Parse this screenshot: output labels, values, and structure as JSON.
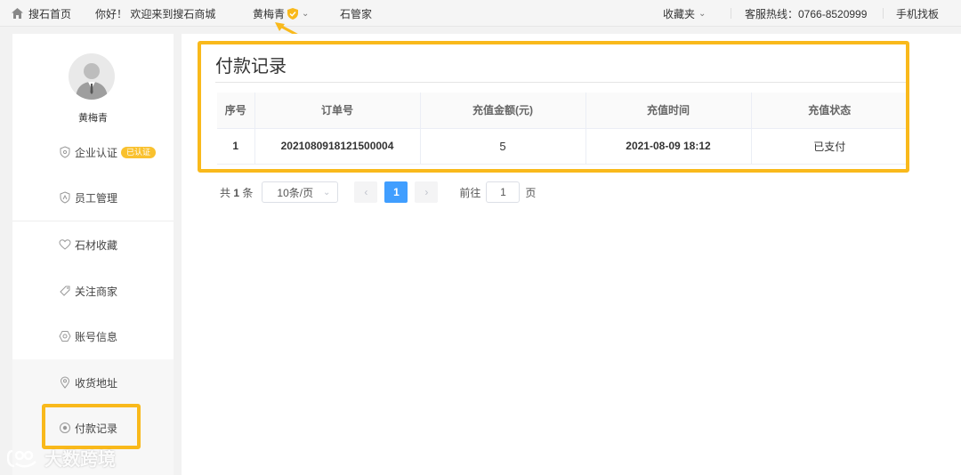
{
  "topbar": {
    "home_label": "搜石首页",
    "greeting": "你好！ 欢迎来到搜石商城",
    "user_name": "黄梅青",
    "stone_manager": "石管家",
    "favorites": "收藏夹",
    "hotline": "客服热线：0766-8520999",
    "mobile": "手机找板"
  },
  "sidebar": {
    "username": "黄梅青",
    "items": [
      {
        "label": "企业认证",
        "badge": "已认证"
      },
      {
        "label": "员工管理"
      },
      {
        "label": "石材收藏"
      },
      {
        "label": "关注商家"
      },
      {
        "label": "账号信息"
      },
      {
        "label": "收货地址"
      },
      {
        "label": "付款记录"
      }
    ]
  },
  "main": {
    "title": "付款记录",
    "columns": [
      "序号",
      "订单号",
      "充值金额(元)",
      "充值时间",
      "充值状态"
    ],
    "rows": [
      [
        "1",
        "2021080918121500004",
        "5",
        "2021-08-09 18:12",
        "已支付"
      ]
    ],
    "pager": {
      "total_prefix": "共",
      "total_count": "1",
      "total_suffix": "条",
      "page_size": "10条/页",
      "current_page": "1",
      "goto_label": "前往",
      "goto_value": "1",
      "goto_suffix": "页"
    }
  },
  "watermark": "大数跨境",
  "colors": {
    "highlight": "#f9b91b",
    "primary": "#409eff",
    "badge": "#f9c12e"
  }
}
